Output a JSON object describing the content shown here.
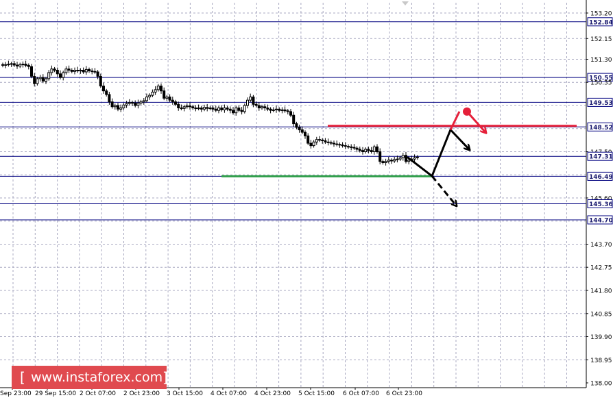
{
  "colors": {
    "level_line": "#00007f",
    "resistance": "#e5203a",
    "support": "#2e9e4a",
    "arrow": "#000000",
    "candle": "#000000",
    "grid": "#a8a8c0",
    "watermark_bg": "#e04a4f"
  },
  "watermark": {
    "text": "www.instaforex.com",
    "open_bracket": "[",
    "close_bracket": "]"
  },
  "chart_data": {
    "type": "candlestick",
    "title": "",
    "xlabel": "",
    "ylabel": "",
    "ylim": [
      137.9,
      153.6
    ],
    "grid": true,
    "price_ticks": [
      "153.20",
      "152.84",
      "152.15",
      "151.30",
      "150.55",
      "150.35",
      "149.53",
      "148.52",
      "147.50",
      "147.31",
      "146.49",
      "145.60",
      "145.36",
      "144.70",
      "143.70",
      "142.75",
      "141.80",
      "140.85",
      "139.90",
      "138.95",
      "138.00"
    ],
    "time_labels": [
      "Sep 23:00",
      "29 Sep 15:00",
      "2 Oct 07:00",
      "2 Oct 23:00",
      "3 Oct 15:00",
      "4 Oct 07:00",
      "4 Oct 23:00",
      "5 Oct 15:00",
      "6 Oct 07:00",
      "6 Oct 23:00"
    ],
    "levels": [
      152.84,
      150.55,
      149.53,
      148.52,
      147.31,
      146.49,
      145.36,
      144.7
    ],
    "resistance_level": 148.52,
    "support_level": 146.49,
    "closes": [
      151.05,
      151.08,
      151.1,
      151.12,
      151.06,
      151.02,
      151.08,
      151.1,
      151.05,
      151.0,
      150.6,
      150.3,
      150.5,
      150.55,
      150.4,
      150.5,
      150.75,
      150.9,
      150.85,
      150.7,
      150.55,
      150.75,
      150.9,
      150.85,
      150.8,
      150.85,
      150.82,
      150.85,
      150.78,
      150.88,
      150.82,
      150.8,
      150.78,
      150.6,
      150.2,
      150.0,
      149.85,
      149.55,
      149.35,
      149.4,
      149.25,
      149.3,
      149.42,
      149.48,
      149.52,
      149.5,
      149.4,
      149.5,
      149.55,
      149.6,
      149.75,
      149.82,
      149.95,
      150.05,
      150.2,
      150.0,
      149.7,
      149.75,
      149.62,
      149.55,
      149.45,
      149.3,
      149.28,
      149.35,
      149.38,
      149.35,
      149.3,
      149.28,
      149.3,
      149.25,
      149.32,
      149.28,
      149.3,
      149.25,
      149.2,
      149.3,
      149.22,
      149.3,
      149.25,
      149.2,
      149.1,
      149.3,
      149.2,
      149.15,
      149.4,
      149.62,
      149.75,
      149.45,
      149.4,
      149.3,
      149.35,
      149.3,
      149.25,
      149.2,
      149.22,
      149.25,
      149.2,
      149.22,
      149.18,
      149.15,
      149.0,
      148.65,
      148.5,
      148.4,
      148.3,
      148.15,
      147.85,
      147.75,
      147.9,
      148.0,
      147.98,
      147.95,
      147.9,
      147.88,
      147.85,
      147.82,
      147.8,
      147.78,
      147.75,
      147.72,
      147.7,
      147.68,
      147.65,
      147.6,
      147.55,
      147.5,
      147.6,
      147.55,
      147.5,
      147.7,
      147.5,
      147.1,
      147.05,
      147.1,
      147.15,
      147.12,
      147.18,
      147.2,
      147.25,
      147.35,
      147.1,
      147.15,
      147.2,
      147.25,
      147.28
    ],
    "projection": {
      "main_path": [
        147.28,
        146.5,
        148.4,
        147.6
      ],
      "down_branch": [
        146.5,
        145.3
      ],
      "up_branch": [
        148.4,
        149.15,
        148.3
      ]
    }
  }
}
